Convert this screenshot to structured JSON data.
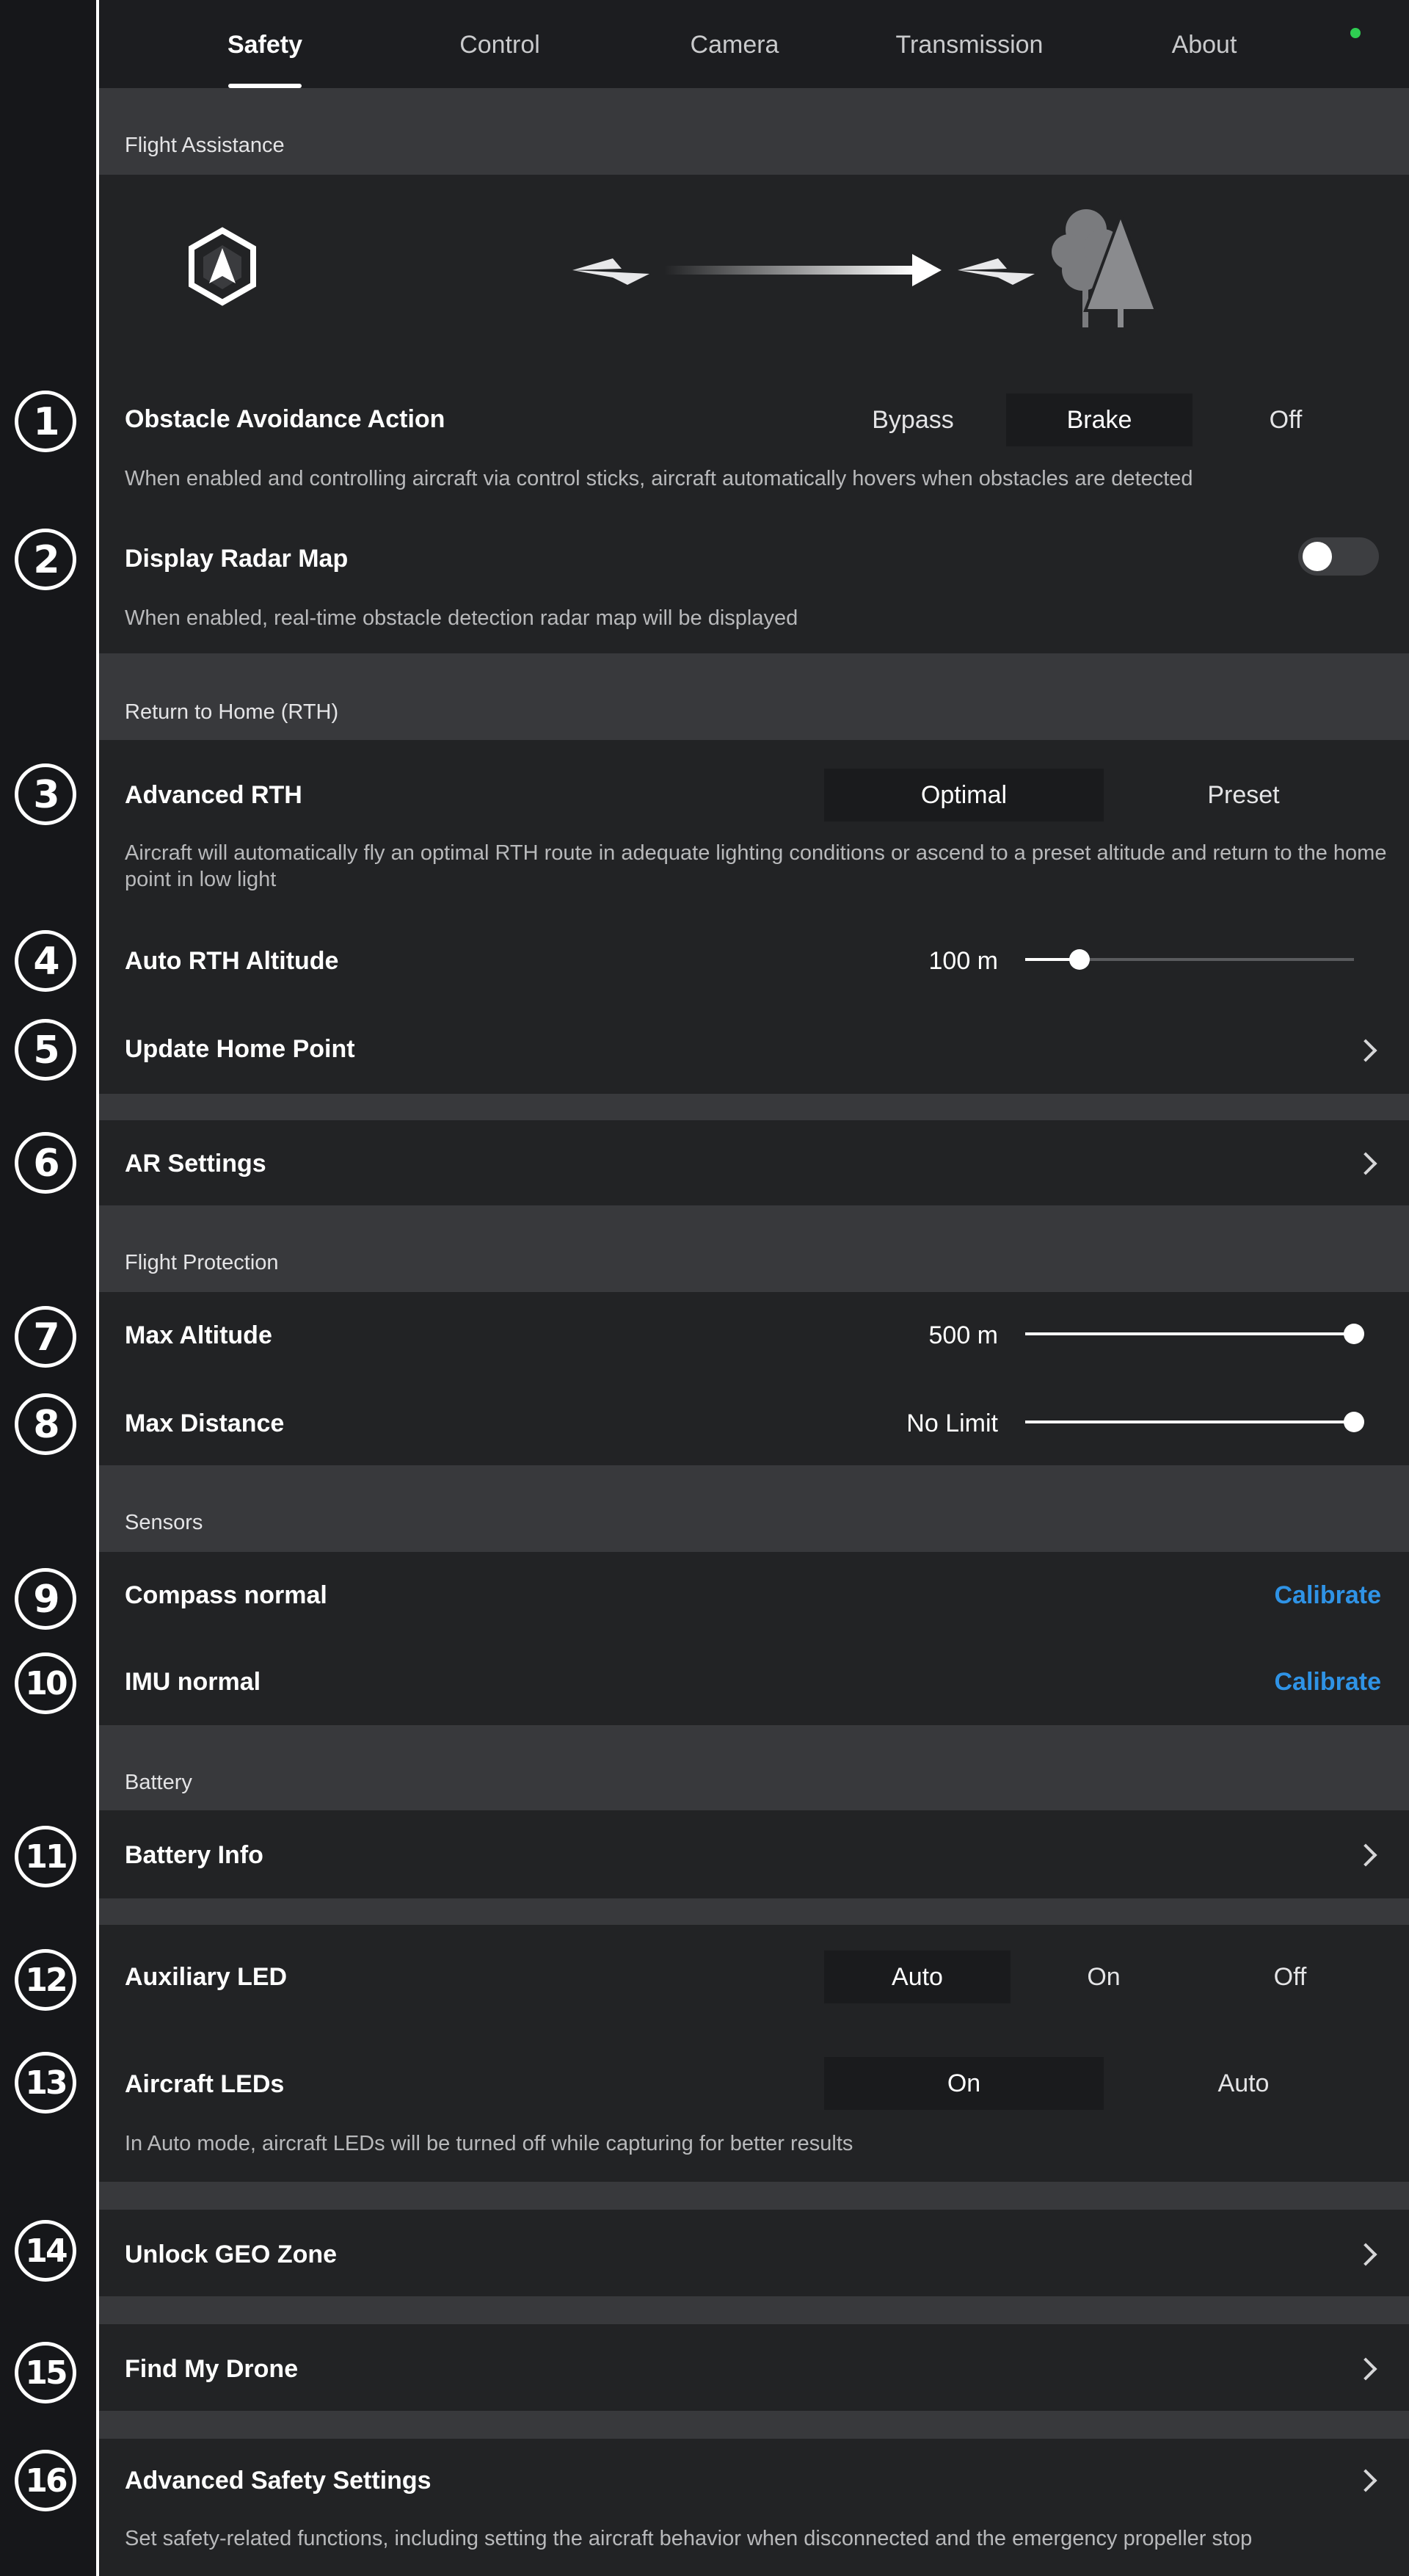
{
  "tabs": [
    {
      "label": "Safety",
      "active": true
    },
    {
      "label": "Control",
      "active": false
    },
    {
      "label": "Camera",
      "active": false
    },
    {
      "label": "Transmission",
      "active": false
    },
    {
      "label": "About",
      "active": false
    }
  ],
  "callouts": [
    "1",
    "2",
    "3",
    "4",
    "5",
    "6",
    "7",
    "8",
    "9",
    "10",
    "11",
    "12",
    "13",
    "14",
    "15",
    "16"
  ],
  "sections": {
    "flight_assistance": "Flight Assistance",
    "rth": "Return to Home (RTH)",
    "flight_protection": "Flight Protection",
    "sensors": "Sensors",
    "battery": "Battery"
  },
  "obstacle": {
    "title": "Obstacle Avoidance Action",
    "options": [
      "Bypass",
      "Brake",
      "Off"
    ],
    "selected": "Brake",
    "desc": "When enabled and controlling aircraft via control sticks, aircraft automatically hovers when obstacles are detected"
  },
  "radar": {
    "title": "Display Radar Map",
    "enabled": false,
    "desc": "When enabled, real-time obstacle detection radar map will be displayed"
  },
  "advanced_rth": {
    "title": "Advanced RTH",
    "options": [
      "Optimal",
      "Preset"
    ],
    "selected": "Optimal",
    "desc": "Aircraft will automatically fly an optimal RTH route in adequate lighting conditions or ascend to a preset altitude and return to the home point in low light"
  },
  "auto_rth_altitude": {
    "title": "Auto RTH Altitude",
    "value": "100 m",
    "fraction": 0.165
  },
  "update_home": {
    "title": "Update Home Point"
  },
  "ar_settings": {
    "title": "AR Settings"
  },
  "max_altitude": {
    "title": "Max Altitude",
    "value": "500 m",
    "fraction": 1.0
  },
  "max_distance": {
    "title": "Max Distance",
    "value": "No Limit",
    "fraction": 1.0
  },
  "compass": {
    "title": "Compass normal",
    "action": "Calibrate"
  },
  "imu": {
    "title": "IMU normal",
    "action": "Calibrate"
  },
  "battery_info": {
    "title": "Battery Info"
  },
  "aux_led": {
    "title": "Auxiliary LED",
    "options": [
      "Auto",
      "On",
      "Off"
    ],
    "selected": "Auto"
  },
  "aircraft_leds": {
    "title": "Aircraft LEDs",
    "options": [
      "On",
      "Auto"
    ],
    "selected": "On",
    "desc": "In Auto mode, aircraft LEDs will be turned off while capturing for better results"
  },
  "unlock_geo": {
    "title": "Unlock GEO Zone"
  },
  "find_drone": {
    "title": "Find My Drone"
  },
  "advanced_safety": {
    "title": "Advanced Safety Settings",
    "desc": "Set safety-related functions, including setting the aircraft behavior when disconnected and the emergency propeller stop"
  },
  "colors": {
    "accent": "#2f93e6",
    "status": "#2fce52",
    "background": "#2b2c2f",
    "card": "#222325"
  }
}
